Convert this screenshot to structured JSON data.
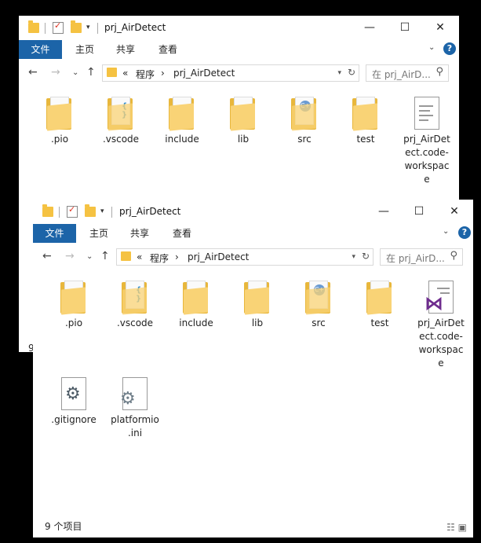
{
  "title": "prj_AirDetect",
  "ribbon": {
    "file": "文件",
    "home": "主页",
    "share": "共享",
    "view": "查看"
  },
  "address": {
    "prefix": "«",
    "crumb1": "程序",
    "sep": "›",
    "crumb2": "prj_AirDetect"
  },
  "search": {
    "placeholder": "在 prj_AirD..."
  },
  "controls": {
    "minimize": "—",
    "maximize": "☐",
    "close": "✕"
  },
  "items": [
    {
      "label": ".pio",
      "icon": "folder-icon"
    },
    {
      "label": ".vscode",
      "icon": "folder-icon"
    },
    {
      "label": "include",
      "icon": "folder-icon"
    },
    {
      "label": "lib",
      "icon": "folder-icon"
    },
    {
      "label": "src",
      "icon": "folder-cpp-icon"
    },
    {
      "label": "test",
      "icon": "folder-icon"
    },
    {
      "label": "prj_AirDetect.code-workspace",
      "icon": "workspace-file-icon"
    },
    {
      "label": ".gitignore",
      "icon": "settings-file-icon"
    },
    {
      "label": "platformio.ini",
      "icon": "ini-file-icon"
    }
  ],
  "workspace_lines": [
    "prj_AirDet",
    "ect.code-",
    "workspac",
    "e"
  ],
  "workspace_lines_back": [
    "prj_AirDet",
    "ect.code-",
    "workspac",
    "e"
  ],
  "platformio_lines": [
    "platformio",
    ".ini"
  ],
  "status": {
    "count": "9 个项目",
    "stub": "9"
  },
  "colors": {
    "accent": "#1c64a8",
    "folder": "#f5c242",
    "vs_purple": "#6e2c8e"
  }
}
